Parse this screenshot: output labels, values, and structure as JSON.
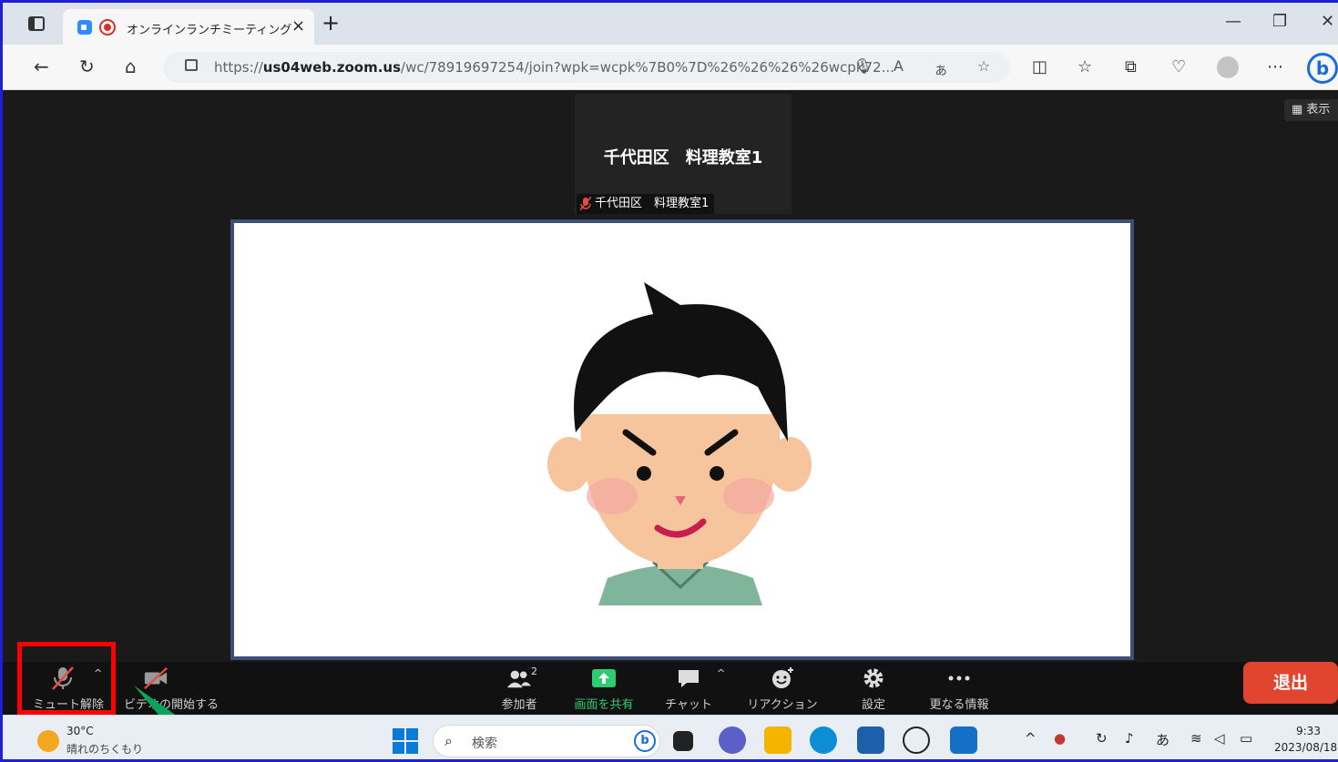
{
  "browser": {
    "tab_title": "オンラインランチミーティング",
    "tab_close": "×",
    "new_tab": "+",
    "url_host": "us04web.zoom.us",
    "url_prefix": "https://",
    "url_path": "/wc/78919697254/join?wpk=wcpk%7B0%7D%26%26%26%26wcpk72...",
    "window_buttons": [
      "—",
      "❐",
      "✕"
    ]
  },
  "meeting": {
    "view_label": "表示",
    "thumbnail_name": "千代田区　料理教室1",
    "thumbnail_label": "千代田区　料理教室1"
  },
  "controls": {
    "mute_label": "ミュート解除",
    "video_label": "ビデオの開始する",
    "participants_label": "参加者",
    "participants_count": "2",
    "share_label": "画面を共有",
    "chat_label": "チャット",
    "reaction_label": "リアクション",
    "settings_label": "設定",
    "more_label": "更なる情報",
    "leave_label": "退出"
  },
  "taskbar": {
    "temperature": "30°C",
    "weather": "晴れのちくもり",
    "search_placeholder": "検索",
    "ime": "あ",
    "time": "9:33",
    "date": "2023/08/18"
  },
  "colors": {
    "frame_border": "#1f1fd6",
    "leave_button": "#e2452f",
    "share_green": "#2ecc71",
    "highlight": "#ff0000",
    "arrow": "#0aa35a"
  }
}
